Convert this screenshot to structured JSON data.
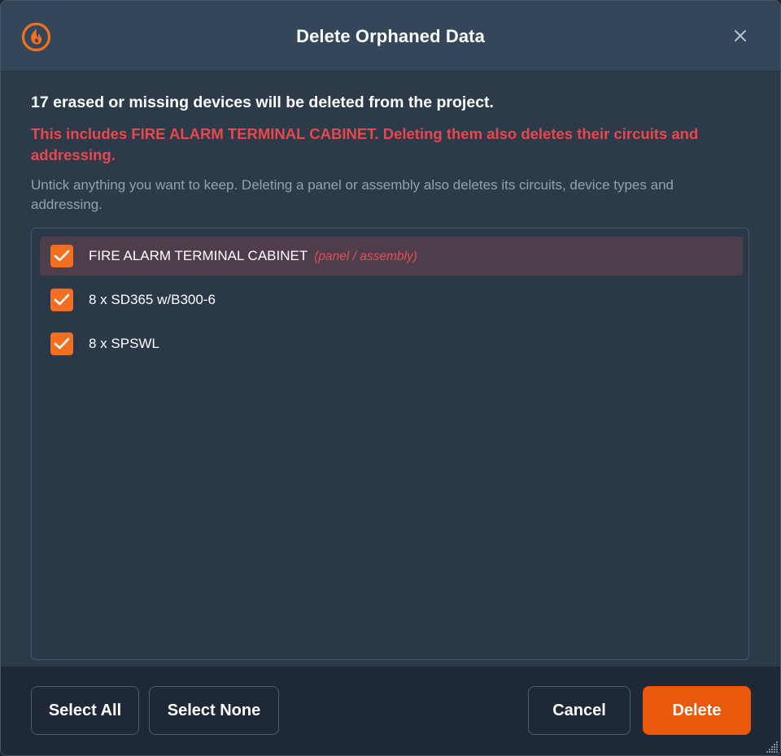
{
  "dialog": {
    "title": "Delete Orphaned Data",
    "logo_icon": "flame-logo-icon",
    "close_icon": "close-icon"
  },
  "content": {
    "headline": "17 erased or missing devices will be deleted from the project.",
    "warning": "This includes FIRE ALARM TERMINAL CABINET. Deleting them also deletes their circuits and addressing.",
    "hint": "Untick anything you want to keep. Deleting a panel or assembly also deletes its circuits, device types and addressing.",
    "items": [
      {
        "label": "FIRE ALARM TERMINAL CABINET",
        "tag": "(panel / assembly)",
        "checked": true,
        "highlighted": true
      },
      {
        "label": "8 x SD365 w/B300-6",
        "tag": "",
        "checked": true,
        "highlighted": false
      },
      {
        "label": "8 x SPSWL",
        "tag": "",
        "checked": true,
        "highlighted": false
      }
    ]
  },
  "footer": {
    "select_all": "Select All",
    "select_none": "Select None",
    "cancel": "Cancel",
    "delete": "Delete"
  },
  "colors": {
    "accent": "#ea580c",
    "checkbox": "#f26f21",
    "warning": "#e8484d",
    "highlight_row": "#4e3d4b"
  }
}
